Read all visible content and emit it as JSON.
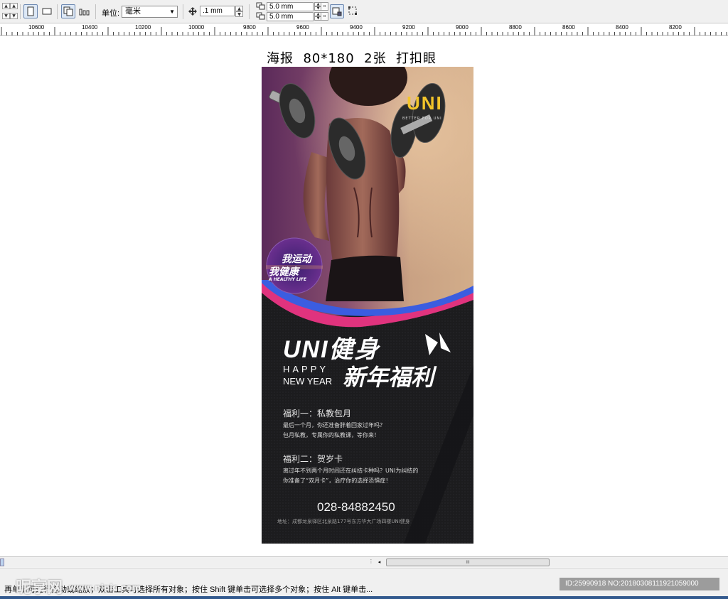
{
  "toolbar": {
    "unit_label": "单位:",
    "unit_value": "毫米",
    "nudge_value": ".1 mm",
    "dup_x_value": "5.0 mm",
    "dup_y_value": "5.0 mm"
  },
  "ruler": {
    "ticks": [
      "10600",
      "10400",
      "10200",
      "10000",
      "9800",
      "9600",
      "9400",
      "9200",
      "9000",
      "8800",
      "8600",
      "8400",
      "8200"
    ]
  },
  "canvas": {
    "poster_title": "海报  80*180  2张  打扣眼"
  },
  "poster": {
    "logo": "UNI",
    "logo_tagline": "BETTER FOR UNI",
    "badge_line1": "我运动",
    "badge_line2": "我健康",
    "badge_line3": "A HEALTHY LIFE",
    "headline": "UNI健身",
    "happy": "HAPPY",
    "new_year": "NEW YEAR",
    "subheadline": "新年福利",
    "benefit1_title": "福利一：私教包月",
    "benefit1_line1": "最后一个月，你还准备胖着回家过年吗？",
    "benefit1_line2": "包月私教，专属你的私教课，等你来！",
    "benefit2_title": "福利二：贺岁卡",
    "benefit2_line1": "离过年不到两个月时间还在纠结卡种吗？UNI为纠结的",
    "benefit2_line2": "你准备了“双月卡”，治疗你的选择恐惧症！",
    "phone": "028-84882450",
    "address": "地址：成都龙泉驿区北泉路177号东方华大广场四楼UNI健身"
  },
  "scrollbar": {
    "thumb_grip": "III"
  },
  "status": {
    "hint": "再单击可进行拖动或缩放；双击工具可选择所有对象；按住 Shift 键单击可选择多个对象；按住 Alt 键单击...",
    "watermark": "昵享网",
    "watermark_url": "www.nipic.com",
    "image_id": "ID:25990918 NO:20180308111921059000"
  },
  "colors": {
    "accent_yellow": "#f3c52a",
    "wave_pink": "#e0337e",
    "wave_blue": "#3b5de0",
    "badge_purple": "#5a2a8c"
  }
}
